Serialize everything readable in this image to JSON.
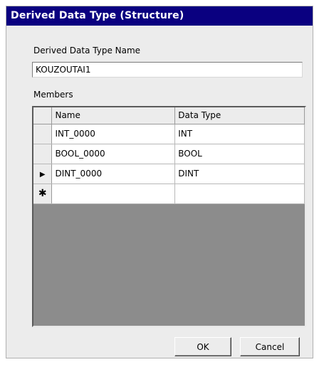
{
  "dialog": {
    "title": "Derived Data Type (Structure)",
    "name_label": "Derived Data Type Name",
    "name_value": "KOUZOUTAI1",
    "members_label": "Members"
  },
  "grid": {
    "columns": [
      "Name",
      "Data Type"
    ],
    "rows": [
      {
        "indicator": "",
        "name": "INT_0000",
        "type": "INT"
      },
      {
        "indicator": "▶",
        "name": "BOOL_0000",
        "type": "BOOL"
      },
      {
        "indicator": "▶",
        "name": "DINT_0000",
        "type": "DINT"
      },
      {
        "indicator": "✱",
        "name": "",
        "type": ""
      }
    ]
  },
  "buttons": {
    "ok": "OK",
    "cancel": "Cancel"
  }
}
